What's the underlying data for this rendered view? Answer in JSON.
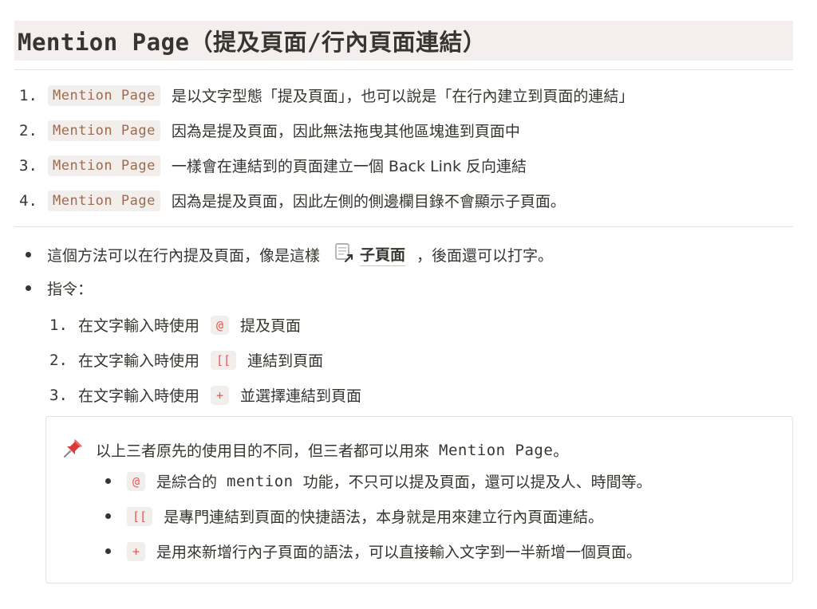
{
  "heading": "Mention Page（提及頁面/行內頁面連結）",
  "numbered_list": [
    {
      "num": "1.",
      "code": "Mention Page",
      "text": "是以文字型態「提及頁面」，也可以說是「在行內建立到頁面的連結」"
    },
    {
      "num": "2.",
      "code": "Mention Page",
      "text": "因為是提及頁面，因此無法拖曳其他區塊進到頁面中"
    },
    {
      "num": "3.",
      "code": "Mention Page",
      "text": "一樣會在連結到的頁面建立一個 Back Link 反向連結"
    },
    {
      "num": "4.",
      "code": "Mention Page",
      "text": "因為是提及頁面，因此左側的側邊欄目錄不會顯示子頁面。"
    }
  ],
  "bullet1": {
    "text_before": "這個方法可以在行內提及頁面，像是這樣",
    "page_link": "子頁面",
    "page_icon": "page-with-arrow-icon",
    "text_after": "，後面還可以打字。"
  },
  "bullet2": {
    "text": "指令：",
    "steps": [
      {
        "num": "1.",
        "prefix": "在文字輸入時使用",
        "code": "@",
        "suffix": "提及頁面"
      },
      {
        "num": "2.",
        "prefix": "在文字輸入時使用",
        "code": "[[",
        "suffix": "連結到頁面"
      },
      {
        "num": "3.",
        "prefix": "在文字輸入時使用",
        "code": "+",
        "suffix": "並選擇連結到頁面"
      }
    ]
  },
  "callout": {
    "icon": "pushpin-icon",
    "title_text": "以上三者原先的使用目的不同，但三者都可以用來",
    "title_mono": "Mention Page",
    "title_end": "。",
    "items": [
      {
        "code": "@",
        "text_a": "是綜合的",
        "mono": "mention",
        "text_b": "功能，不只可以提及頁面，還可以提及人、時間等。"
      },
      {
        "code": "[[",
        "text": "是專門連結到頁面的快捷語法，本身就是用來建立行內頁面連結。"
      },
      {
        "code": "+",
        "text": "是用來新增行內子頁面的語法，可以直接輸入文字到一半新增一個頁面。"
      }
    ]
  },
  "colors": {
    "code_tag": "#9d6b4f",
    "code_red": "#eb5757",
    "heading_bg": "#f4efee",
    "text": "#37352f"
  }
}
